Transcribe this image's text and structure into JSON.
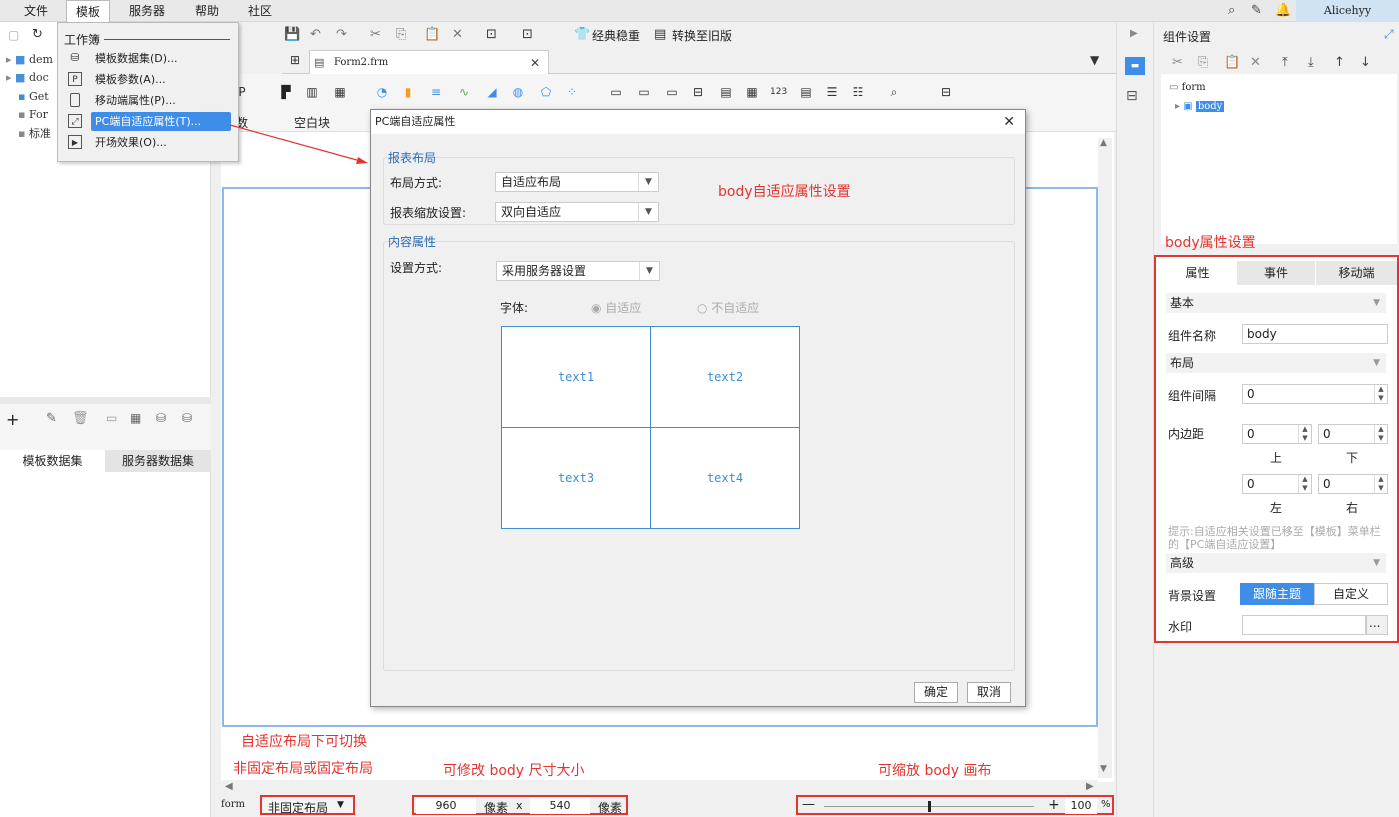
{
  "menubar": {
    "items": [
      "文件",
      "模板",
      "服务器",
      "帮助",
      "社区"
    ],
    "user": "Alicehyy"
  },
  "template_menu": {
    "header": "工作簿",
    "items": [
      {
        "label": "模板数据集(D)...",
        "icon": "database-icon"
      },
      {
        "label": "模板参数(A)...",
        "icon": "parameter-icon"
      },
      {
        "label": "移动端属性(P)...",
        "icon": "mobile-icon"
      },
      {
        "label": "PC端自适应属性(T)...",
        "icon": "adaptive-icon",
        "selected": true
      },
      {
        "label": "开场效果(O)...",
        "icon": "intro-effect-icon"
      }
    ]
  },
  "left_tree": [
    "dem",
    "doc",
    "Get",
    "For",
    "标准"
  ],
  "left_tabs": [
    "模板数据集",
    "服务器数据集"
  ],
  "toolbar": {
    "classic_label": "经典稳重",
    "legacy_label": "转换至旧版"
  },
  "doc_tab": "Form2.frm",
  "widget_groups": [
    "数",
    "空白块"
  ],
  "dialog": {
    "title": "PC端自适应属性",
    "section1": "报表布局",
    "layout_label": "布局方式:",
    "layout_value": "自适应布局",
    "zoom_label": "报表缩放设置:",
    "zoom_value": "双向自适应",
    "section2": "内容属性",
    "mode_label": "设置方式:",
    "mode_value": "采用服务器设置",
    "font_label": "字体:",
    "radio_adaptive": "自适应",
    "radio_not_adaptive": "不自适应",
    "cells": [
      "text1",
      "text2",
      "text3",
      "text4"
    ],
    "ok": "确定",
    "cancel": "取消"
  },
  "annotations": {
    "dialog_note": "body自适应属性设置",
    "props_note": "body属性设置",
    "switch_line1": "自适应布局下可切换",
    "switch_line2": "非固定布局或固定布局",
    "size_note": "可修改 body 尺寸大小",
    "zoom_note": "可缩放 body 画布"
  },
  "statusbar": {
    "form": "form",
    "layout": "非固定布局",
    "width": "960",
    "unit1": "像素",
    "x": "x",
    "height": "540",
    "unit2": "像素",
    "zoom": "100",
    "percent": "%",
    "zoom_level": 0.5
  },
  "right_panel": {
    "title": "组件设置",
    "tree_root": "form",
    "tree_child": "body",
    "tabs": [
      "属性",
      "事件",
      "移动端"
    ],
    "basic": "基本",
    "name_label": "组件名称",
    "name_value": "body",
    "layout": "布局",
    "gap_label": "组件间隔",
    "gap_value": "0",
    "padding_label": "内边距",
    "pad_top": "0",
    "pad_bottom": "0",
    "pad_left": "0",
    "pad_right": "0",
    "top": "上",
    "bottom": "下",
    "left": "左",
    "right": "右",
    "hint": "提示:自适应相关设置已移至【模板】菜单栏的【PC端自适应设置】",
    "advanced": "高级",
    "bg_label": "背景设置",
    "bg_follow": "跟随主题",
    "bg_custom": "自定义",
    "watermark_label": "水印",
    "watermark_btn": "..."
  },
  "colors": {
    "annotation": "#e3342f",
    "accent": "#3e8ee9",
    "cell_border": "#3c8ed4"
  }
}
